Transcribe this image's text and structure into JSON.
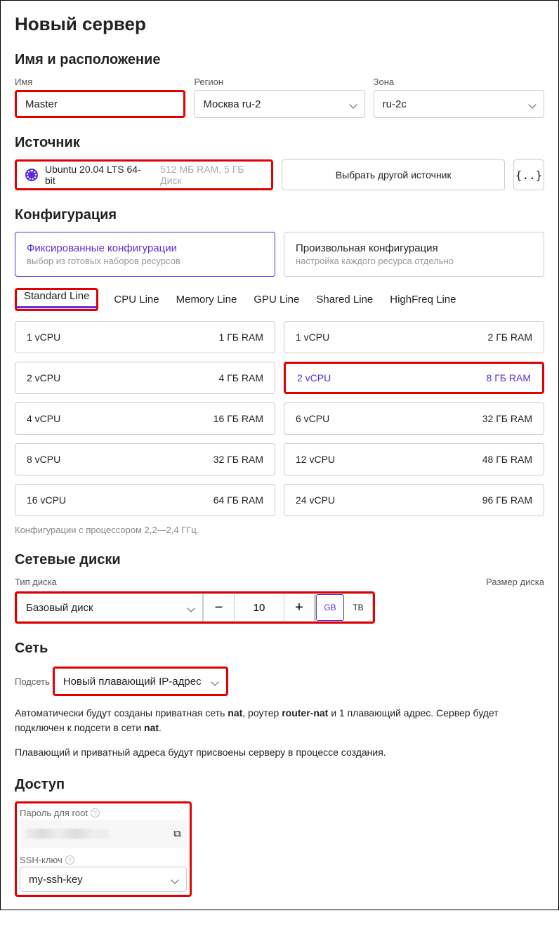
{
  "page_title": "Новый сервер",
  "sections": {
    "name_location": "Имя и расположение",
    "source": "Источник",
    "configuration": "Конфигурация",
    "disks": "Сетевые диски",
    "network": "Сеть",
    "access": "Доступ"
  },
  "name_field": {
    "label": "Имя",
    "value": "Master"
  },
  "region_field": {
    "label": "Регион",
    "value": "Москва ru-2"
  },
  "zone_field": {
    "label": "Зона",
    "value": "ru-2c"
  },
  "source": {
    "os": "Ubuntu 20.04 LTS 64-bit",
    "reqs": "512 МБ RAM, 5 ГБ Диск",
    "other": "Выбрать другой источник",
    "code_btn": "{..}"
  },
  "config_cards": {
    "fixed_title": "Фиксированные конфигурации",
    "fixed_sub": "выбор из готовых наборов ресурсов",
    "custom_title": "Произвольная конфигурация",
    "custom_sub": "настройка каждого ресурса отдельно"
  },
  "tabs": [
    "Standard Line",
    "CPU Line",
    "Memory Line",
    "GPU Line",
    "Shared Line",
    "HighFreq Line"
  ],
  "flavors": [
    {
      "cpu": "1 vCPU",
      "ram": "1 ГБ RAM",
      "selected": false
    },
    {
      "cpu": "1 vCPU",
      "ram": "2 ГБ RAM",
      "selected": false
    },
    {
      "cpu": "2 vCPU",
      "ram": "4 ГБ RAM",
      "selected": false
    },
    {
      "cpu": "2 vCPU",
      "ram": "8 ГБ RAM",
      "selected": true
    },
    {
      "cpu": "4 vCPU",
      "ram": "16 ГБ RAM",
      "selected": false
    },
    {
      "cpu": "6 vCPU",
      "ram": "32 ГБ RAM",
      "selected": false
    },
    {
      "cpu": "8 vCPU",
      "ram": "32 ГБ RAM",
      "selected": false
    },
    {
      "cpu": "12 vCPU",
      "ram": "48 ГБ RAM",
      "selected": false
    },
    {
      "cpu": "16 vCPU",
      "ram": "64 ГБ RAM",
      "selected": false
    },
    {
      "cpu": "24 vCPU",
      "ram": "96 ГБ RAM",
      "selected": false
    }
  ],
  "flavor_note": "Конфигурации с процессором 2,2—2,4 ГГц.",
  "disk": {
    "type_label": "Тип диска",
    "type_value": "Базовый диск",
    "size_label": "Размер диска",
    "size_value": "10",
    "unit_gb": "GB",
    "unit_tb": "ТВ"
  },
  "network": {
    "subnet_label": "Подсеть",
    "subnet_value": "Новый плавающий IP-адрес",
    "info1_a": "Автоматически будут созданы приватная сеть ",
    "info1_nat": "nat",
    "info1_b": ", роутер ",
    "info1_router": "router-nat",
    "info1_c": " и 1 плавающий адрес. Сервер будет подключен к подсети в сети ",
    "info1_d": ".",
    "info2": "Плавающий и приватный адреса будут присвоены серверу в процессе создания."
  },
  "access": {
    "pwd_label": "Пароль для root",
    "ssh_label": "SSH-ключ",
    "ssh_value": "my-ssh-key"
  }
}
